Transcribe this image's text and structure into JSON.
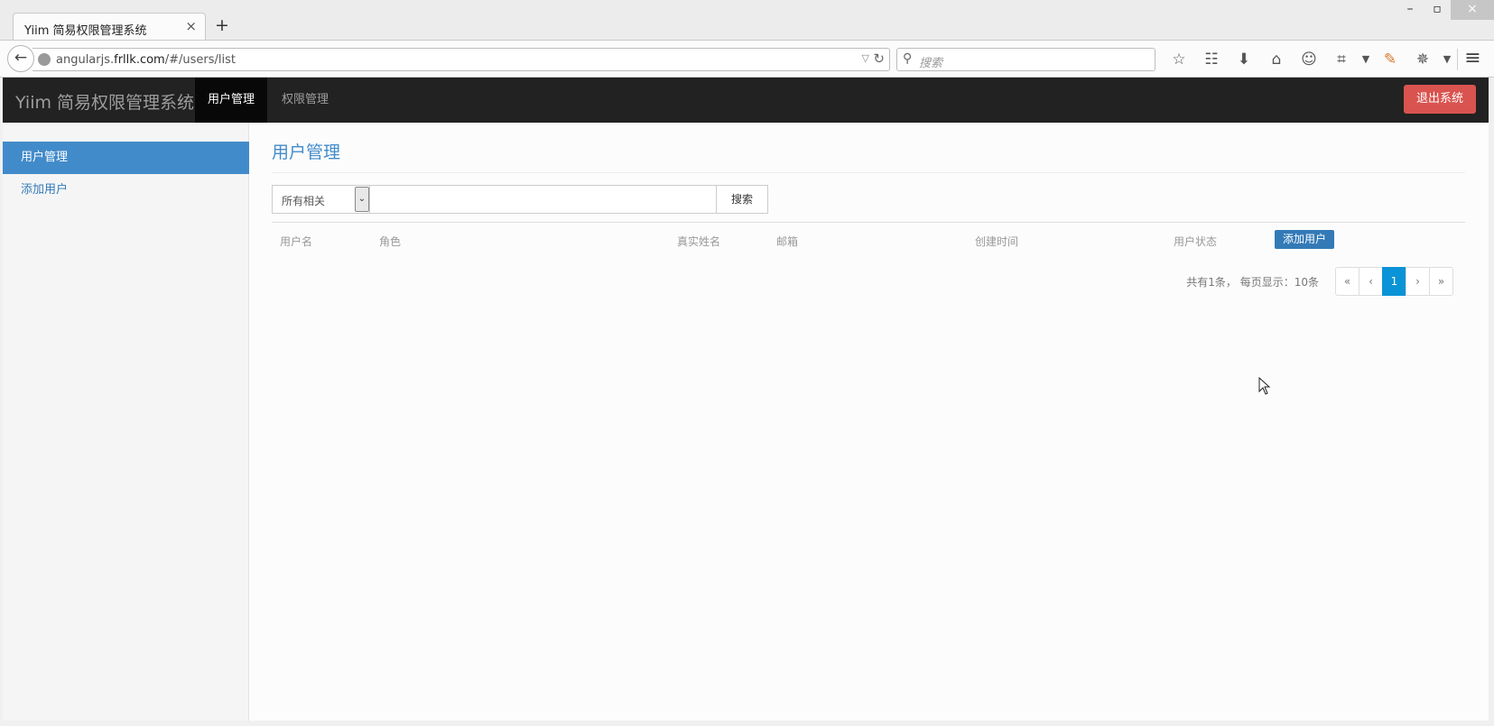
{
  "browser": {
    "tab_title": "Yiim 简易权限管理系统",
    "tab_close": "×",
    "new_tab": "+",
    "window": {
      "minimize": "–",
      "maximize": "▫",
      "close": "×"
    },
    "back": "←",
    "url_host_prefix": "angularjs.",
    "url_host_main": "frllk.com",
    "url_path": "/#/users/list",
    "url_dropdown": "▽",
    "url_reload": "C",
    "search_placeholder": "搜索",
    "toolbar_icons": [
      "star-icon",
      "reader-icon",
      "download-icon",
      "home-icon",
      "chat-icon",
      "crop-icon",
      "dropdown-icon",
      "brush-icon",
      "bug-icon",
      "dropdown-icon"
    ],
    "menu": "≡"
  },
  "app": {
    "brand": "Yiim 简易权限管理系统",
    "nav": [
      {
        "label": "用户管理",
        "active": true
      },
      {
        "label": "权限管理",
        "active": false
      }
    ],
    "logout_label": "退出系统",
    "logout_color": "#d9534f"
  },
  "sidebar": {
    "items": [
      {
        "label": "用户管理",
        "active": true
      },
      {
        "label": "添加用户",
        "active": false
      }
    ],
    "accent": "#428bca"
  },
  "main": {
    "title": "用户管理",
    "search": {
      "filter_selected": "所有相关",
      "keyword_value": "",
      "button_label": "搜索"
    },
    "table": {
      "columns": [
        "用户名",
        "角色",
        "真实姓名",
        "邮箱",
        "创建时间",
        "用户状态"
      ],
      "add_button_label": "添加用户",
      "rows": []
    },
    "pagination": {
      "summary": "共有1条， 每页显示：10条",
      "first": "«",
      "prev": "‹",
      "current": "1",
      "next": "›",
      "last": "»",
      "active_color": "#0a93d6"
    }
  }
}
